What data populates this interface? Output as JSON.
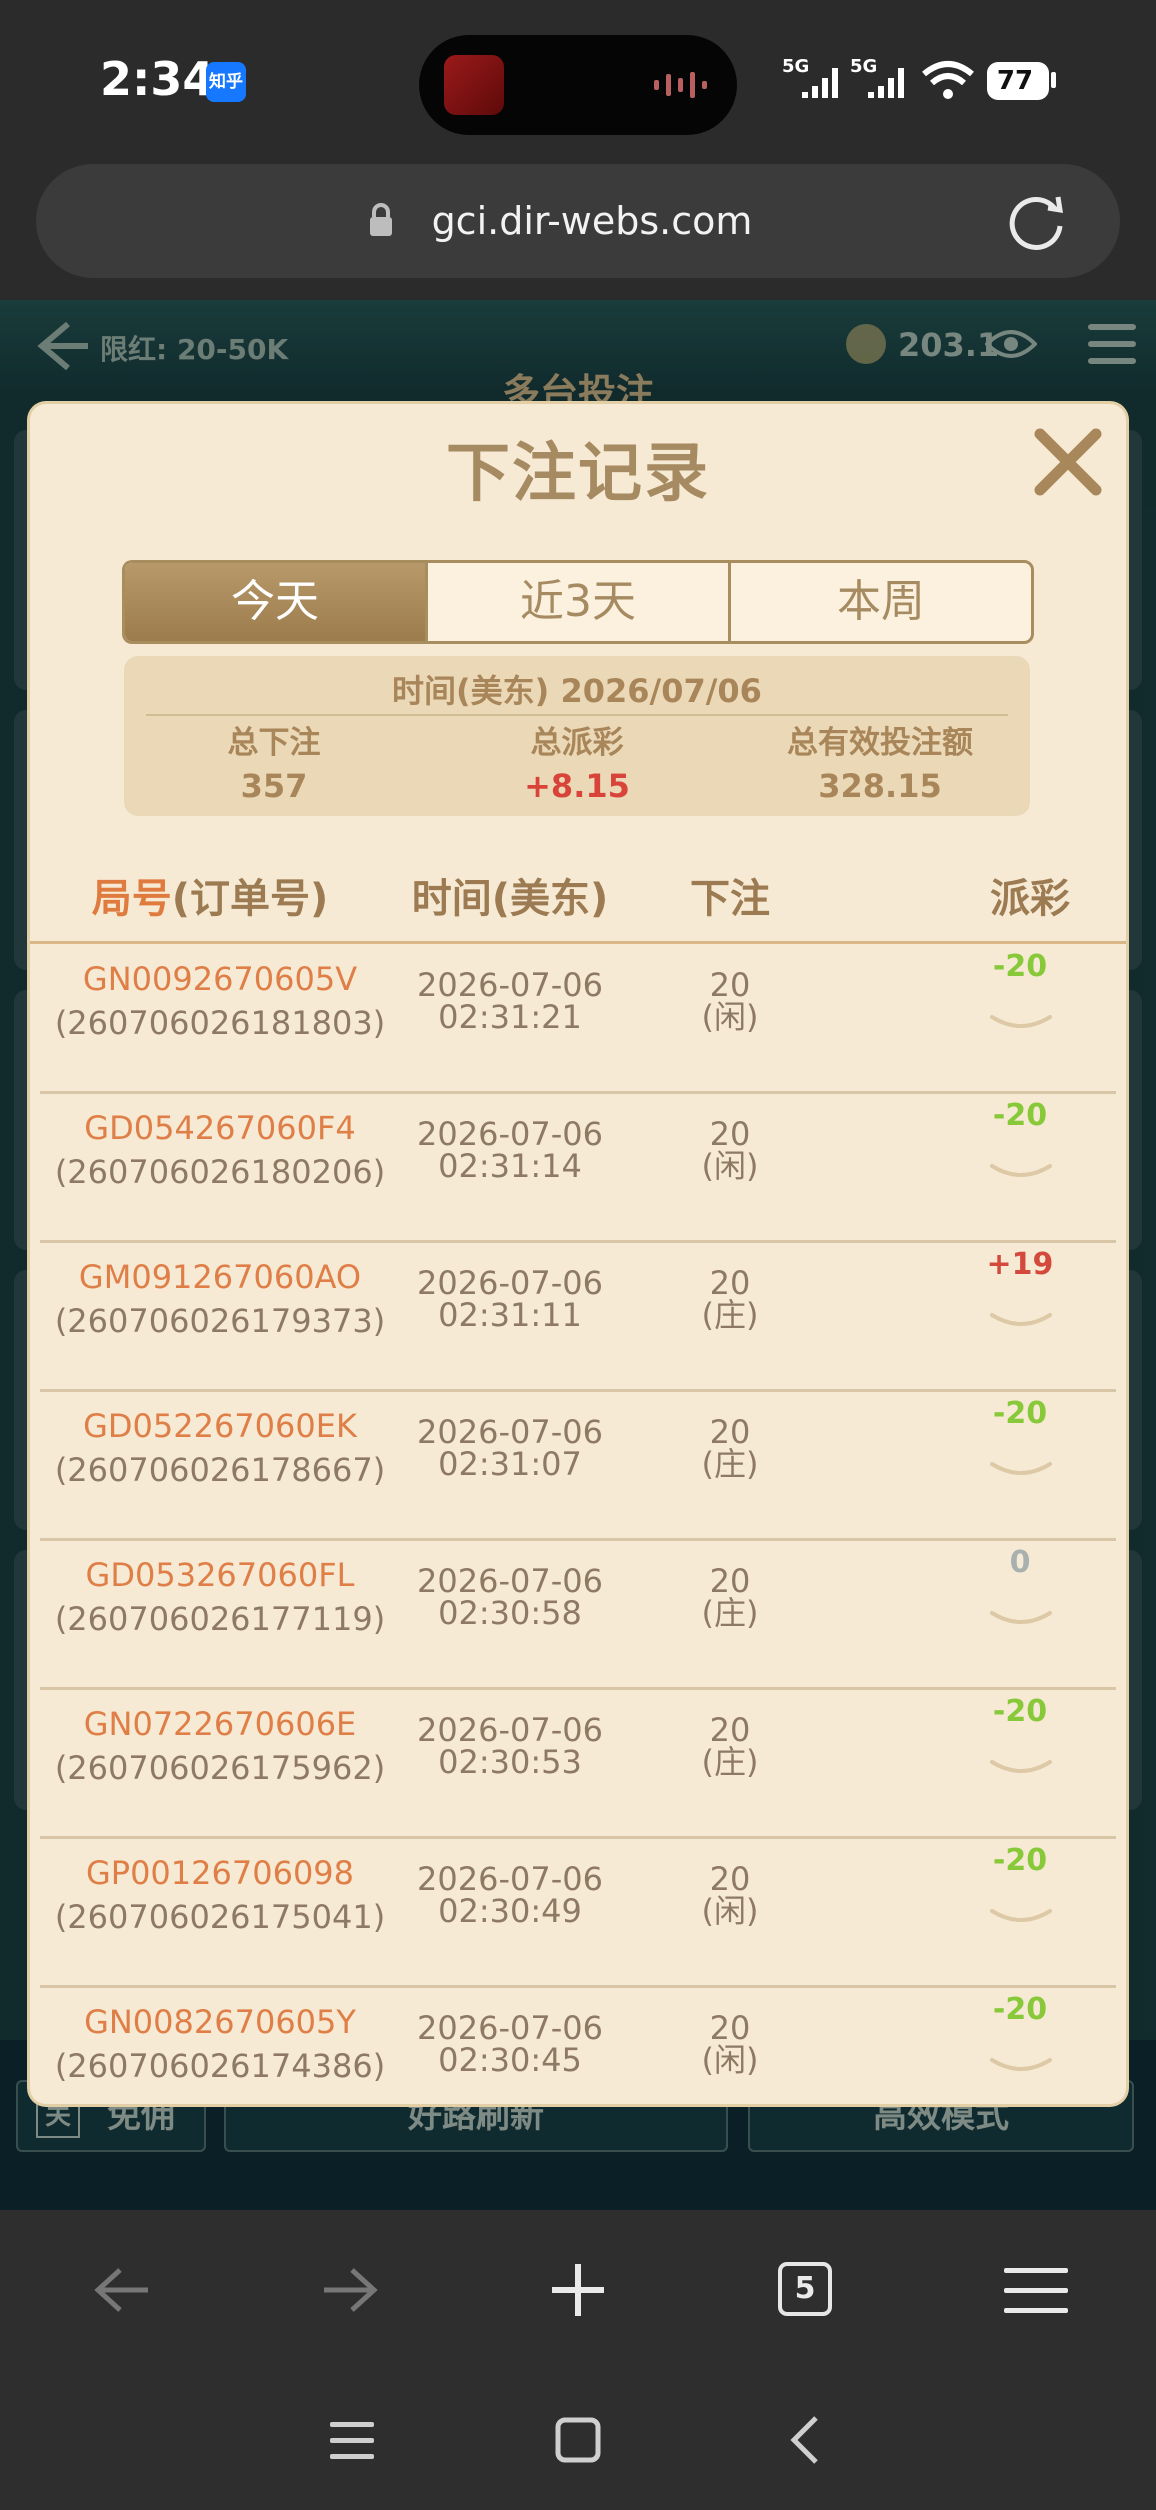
{
  "status": {
    "time": "2:34",
    "zhihu_badge": "知乎",
    "network_1": "5G",
    "network_2": "5G",
    "battery": "77"
  },
  "browser": {
    "url": "gci.dir-webs.com",
    "tab_count": "5"
  },
  "game": {
    "limit": "限红: 20-50K",
    "balance": "203.1",
    "title": "多台投注",
    "controls": {
      "toggle_label": "关",
      "free_label": "免佣",
      "refresh_label": "好路刷新",
      "mode_label": "高效模式"
    }
  },
  "modal": {
    "title": "下注记录",
    "tabs": [
      "今天",
      "近3天",
      "本周"
    ],
    "active_tab": 0,
    "summary": {
      "date": "时间(美东) 2026/07/06",
      "total_bet_label": "总下注",
      "total_bet": "357",
      "total_payout_label": "总派彩",
      "total_payout": "+8.15",
      "total_valid_label": "总有效投注额",
      "total_valid": "328.15"
    },
    "headers": {
      "round_accent": "局号",
      "round_rest": "(订单号)",
      "time": "时间(美东)",
      "bet": "下注",
      "payout": "派彩"
    },
    "rows": [
      {
        "id": "GN0092670605V",
        "order": "(260706026181803)",
        "date": "2026-07-06",
        "time": "02:31:21",
        "bet": "20",
        "side": "(闲)",
        "payout": "-20",
        "result": "loss"
      },
      {
        "id": "GD054267060F4",
        "order": "(260706026180206)",
        "date": "2026-07-06",
        "time": "02:31:14",
        "bet": "20",
        "side": "(闲)",
        "payout": "-20",
        "result": "loss"
      },
      {
        "id": "GM091267060AO",
        "order": "(260706026179373)",
        "date": "2026-07-06",
        "time": "02:31:11",
        "bet": "20",
        "side": "(庄)",
        "payout": "+19",
        "result": "win"
      },
      {
        "id": "GD052267060EK",
        "order": "(260706026178667)",
        "date": "2026-07-06",
        "time": "02:31:07",
        "bet": "20",
        "side": "(庄)",
        "payout": "-20",
        "result": "loss"
      },
      {
        "id": "GD053267060FL",
        "order": "(260706026177119)",
        "date": "2026-07-06",
        "time": "02:30:58",
        "bet": "20",
        "side": "(庄)",
        "payout": "0",
        "result": "zero"
      },
      {
        "id": "GN0722670606E",
        "order": "(260706026175962)",
        "date": "2026-07-06",
        "time": "02:30:53",
        "bet": "20",
        "side": "(庄)",
        "payout": "-20",
        "result": "loss"
      },
      {
        "id": "GP00126706098",
        "order": "(260706026175041)",
        "date": "2026-07-06",
        "time": "02:30:49",
        "bet": "20",
        "side": "(闲)",
        "payout": "-20",
        "result": "loss"
      },
      {
        "id": "GN0082670605Y",
        "order": "(260706026174386)",
        "date": "2026-07-06",
        "time": "02:30:45",
        "bet": "20",
        "side": "(闲)",
        "payout": "-20",
        "result": "loss"
      }
    ]
  },
  "colors": {
    "loss": "#88c93a",
    "win": "#d34a3c",
    "zero": "#a8b1b0"
  },
  "icons": [
    "back-arrow-icon",
    "coin-icon",
    "eye-icon",
    "menu-icon",
    "close-icon",
    "chevron-down-icon",
    "lock-icon",
    "reload-icon",
    "plus-icon",
    "tabs-icon",
    "hamburger-icon",
    "home-icon"
  ]
}
